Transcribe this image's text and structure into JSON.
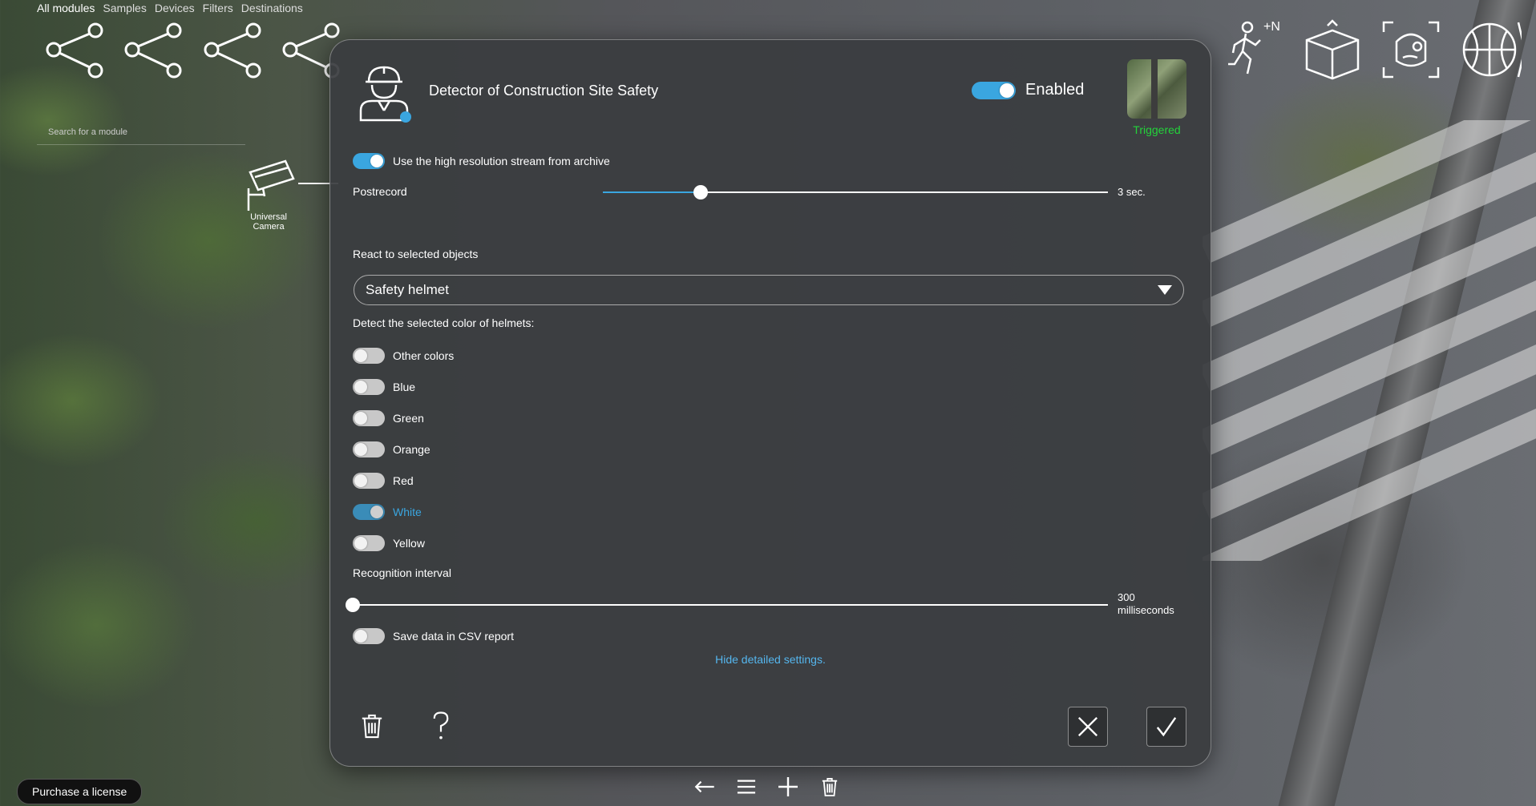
{
  "topnav": {
    "items": [
      "All modules",
      "Samples",
      "Devices",
      "Filters",
      "Destinations"
    ]
  },
  "search": {
    "placeholder": "Search for a module"
  },
  "camera_node": {
    "label_line1": "Universal",
    "label_line2": "Camera"
  },
  "module_icons": [
    "share-icon",
    "share-icon",
    "share-icon",
    "share-icon",
    "running-person-count-icon",
    "box-icon",
    "face-scan-icon",
    "ball-icon"
  ],
  "module_icon_labels": {
    "person_count": "+N"
  },
  "modal": {
    "title": "Detector of Construction Site Safety",
    "enabled_label": "Enabled",
    "enabled": true,
    "triggered_label": "Triggered",
    "hires_label": "Use the high resolution stream from archive",
    "hires_on": true,
    "postrecord": {
      "label": "Postrecord",
      "value_text": "3 sec.",
      "fraction": 0.193
    },
    "react_label": "React to selected objects",
    "react_value": "Safety helmet",
    "colors_label": "Detect the selected color of helmets:",
    "colors": [
      {
        "label": "Other colors",
        "on": false
      },
      {
        "label": "Blue",
        "on": false
      },
      {
        "label": "Green",
        "on": false
      },
      {
        "label": "Orange",
        "on": false
      },
      {
        "label": "Red",
        "on": false
      },
      {
        "label": "White",
        "on": true
      },
      {
        "label": "Yellow",
        "on": false
      }
    ],
    "interval": {
      "label": "Recognition interval",
      "value_line1": "300",
      "value_line2": "milliseconds",
      "fraction": 0.0
    },
    "csv_label": "Save data in CSV report",
    "csv_on": false,
    "hide_link": "Hide detailed settings."
  },
  "purchase_label": "Purchase a license",
  "accent_color": "#3aa6e0",
  "triggered_color": "#23d33a"
}
